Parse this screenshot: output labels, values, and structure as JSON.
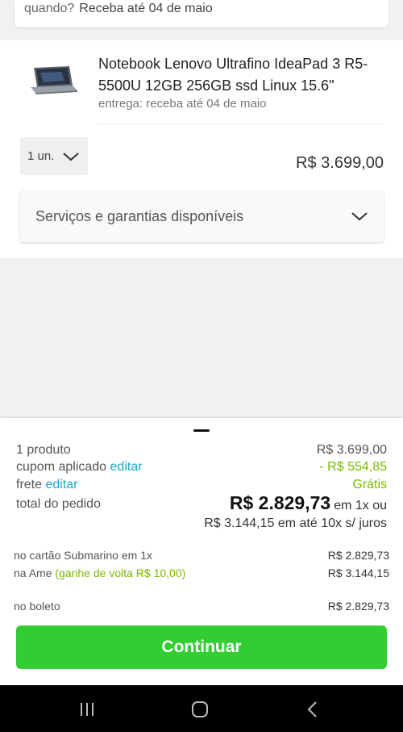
{
  "top": {
    "question": "quando?",
    "delivery": "Receba até 04 de maio"
  },
  "product": {
    "title": "Notebook Lenovo Ultrafino IdeaPad 3 R5-5500U 12GB 256GB ssd Linux 15.6\"",
    "delivery": "entrega: receba até 04 de maio",
    "quantity": "1 un.",
    "price": "R$ 3.699,00"
  },
  "services": {
    "label": "Serviços e garantias disponíveis"
  },
  "summary": {
    "products_label": "1 produto",
    "products_value": "R$ 3.699,00",
    "coupon_label": "cupom aplicado",
    "coupon_edit": "editar",
    "coupon_value": "- R$ 554,85",
    "shipping_label": "frete",
    "shipping_edit": "editar",
    "shipping_value": "Grátis",
    "total_label": "total do pedido",
    "total_value": "R$ 2.829,73",
    "total_suffix": "em 1x ou",
    "installments": "R$ 3.144,15 em até 10x s/ juros"
  },
  "payment": {
    "card_label": "no cartão Submarino em 1x",
    "card_value": "R$ 2.829,73",
    "ame_label": "na Ame",
    "ame_cashback": "(ganhe de volta R$ 10,00)",
    "ame_value": "R$ 3.144,15",
    "boleto_label": "no boleto",
    "boleto_value": "R$ 2.829,73"
  },
  "continue_label": "Continuar",
  "colors": {
    "green_button": "#33cc33",
    "link": "#1aa6cf",
    "discount": "#7ab800"
  }
}
